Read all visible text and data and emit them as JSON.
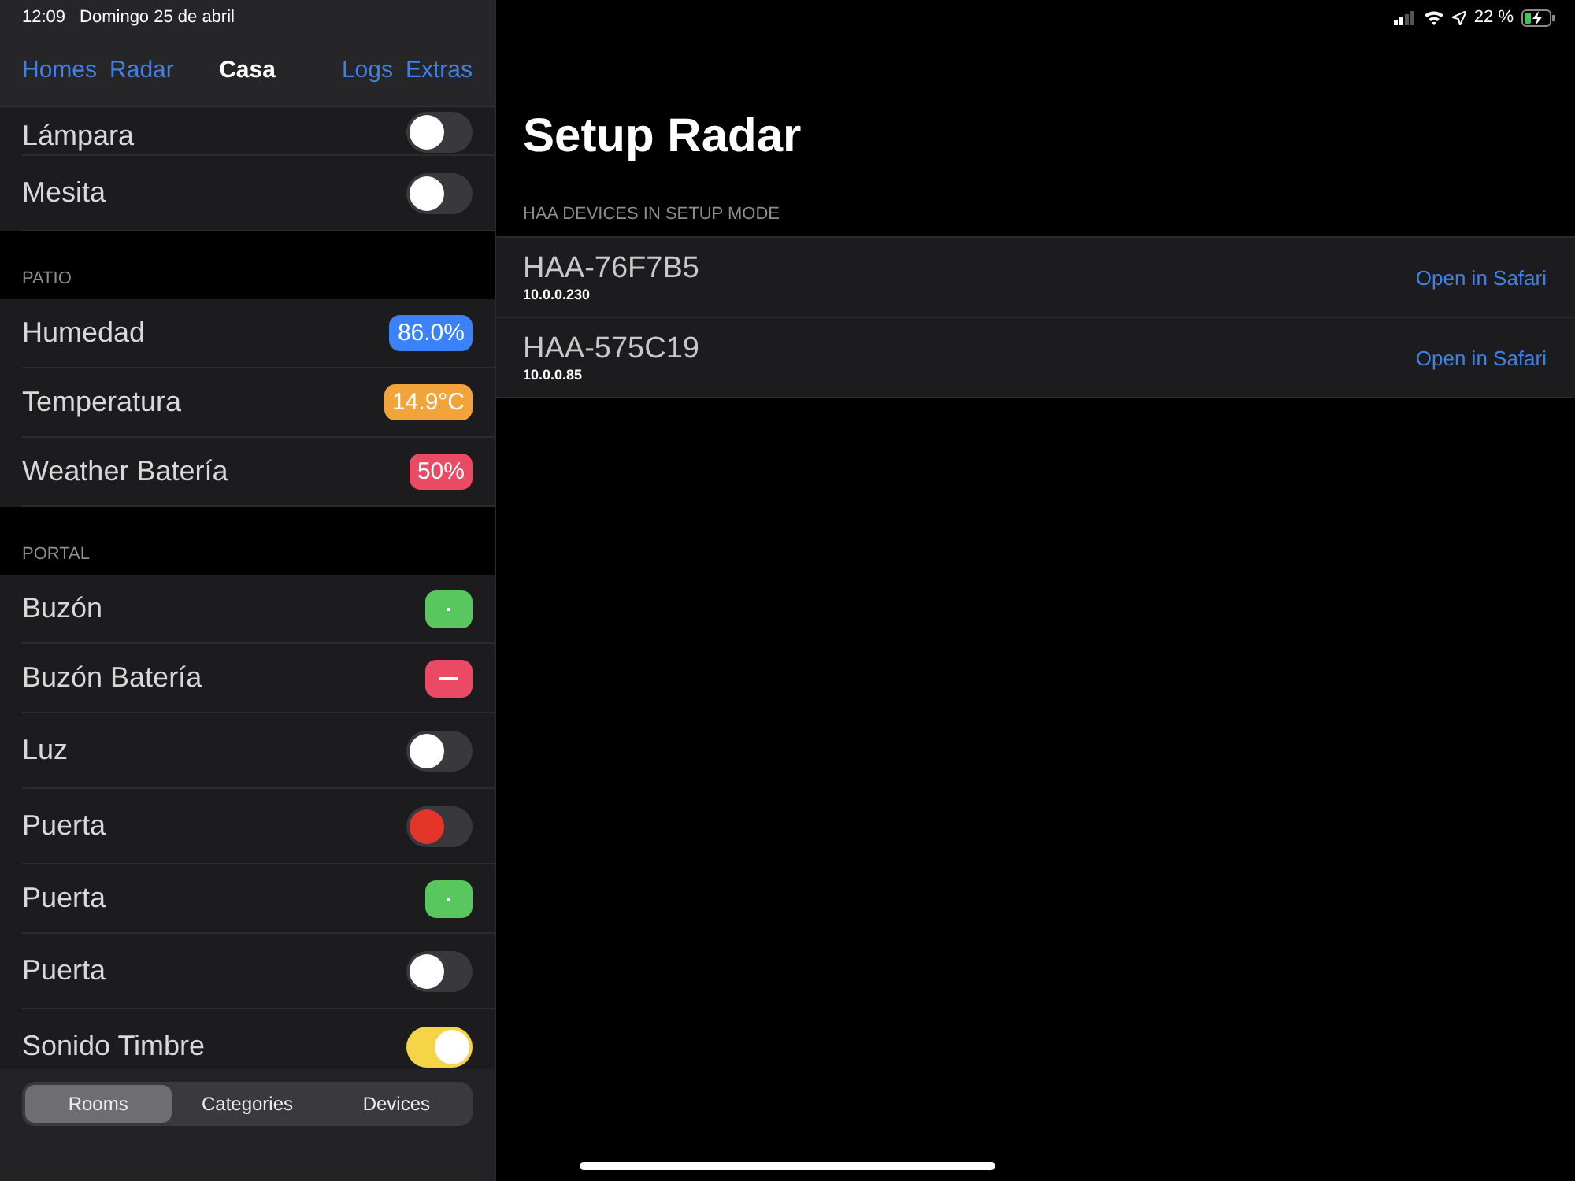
{
  "status_bar": {
    "time": "12:09",
    "date": "Domingo 25 de abril",
    "battery_text": "22 %"
  },
  "nav": {
    "left": [
      "Homes",
      "Radar"
    ],
    "title": "Casa",
    "right": [
      "Logs",
      "Extras"
    ]
  },
  "sections": [
    {
      "rows": [
        {
          "kind": "toggle",
          "label": "Lámpara",
          "on": false
        },
        {
          "kind": "toggle",
          "label": "Mesita",
          "on": false
        }
      ]
    },
    {
      "header": "PATIO",
      "rows": [
        {
          "kind": "badge",
          "label": "Humedad",
          "value": "86.0%",
          "color": "#3b82f6"
        },
        {
          "kind": "badge",
          "label": "Temperatura",
          "value": "14.9°C",
          "color": "#f2a33a"
        },
        {
          "kind": "badge",
          "label": "Weather Batería",
          "value": "50%",
          "color": "#ea4a63"
        }
      ]
    },
    {
      "header": "PORTAL",
      "rows": [
        {
          "kind": "dot",
          "label": "Buzón",
          "color": "#5ac75e"
        },
        {
          "kind": "dash",
          "label": "Buzón Batería",
          "color": "#ea4a63"
        },
        {
          "kind": "toggle",
          "label": "Luz",
          "on": false
        },
        {
          "kind": "toggle",
          "label": "Puerta",
          "on": false,
          "color": "#e5352b"
        },
        {
          "kind": "dot",
          "label": "Puerta",
          "color": "#5ac75e"
        },
        {
          "kind": "toggle",
          "label": "Puerta",
          "on": false
        },
        {
          "kind": "toggle",
          "label": "Sonido Timbre",
          "on": true
        }
      ]
    }
  ],
  "segments": [
    {
      "label": "Rooms",
      "selected": true
    },
    {
      "label": "Categories",
      "selected": false
    },
    {
      "label": "Devices",
      "selected": false
    }
  ],
  "detail": {
    "title": "Setup Radar",
    "section": "HAA DEVICES IN SETUP MODE",
    "devices": [
      {
        "name": "HAA-76F7B5",
        "ip": "10.0.0.230",
        "action": "Open in Safari"
      },
      {
        "name": "HAA-575C19",
        "ip": "10.0.0.85",
        "action": "Open in Safari"
      }
    ]
  }
}
